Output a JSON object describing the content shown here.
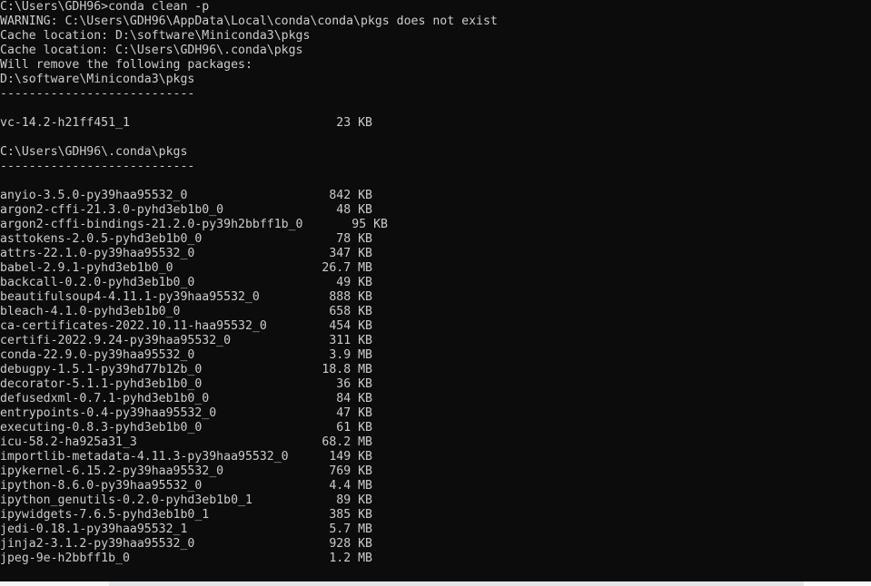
{
  "window": {
    "title": "Command Prompt - conda clean -p",
    "background_color": "#0c0c0c",
    "foreground_color": "#cccccc"
  },
  "console": {
    "prompt_line": "C:\\Users\\GDH96>conda clean -p",
    "warning_line": "WARNING: C:\\Users\\GDH96\\AppData\\Local\\conda\\conda\\pkgs does not exist",
    "cache_location_1": "Cache location: D:\\software\\Miniconda3\\pkgs",
    "cache_location_2": "Cache location: C:\\Users\\GDH96\\.conda\\pkgs",
    "will_remove_line": "Will remove the following packages:",
    "separator": "---------------------------",
    "section_1": {
      "path": "D:\\software\\Miniconda3\\pkgs",
      "packages": [
        {
          "name": "vc-14.2-h21ff451_1",
          "size": "23 KB"
        }
      ]
    },
    "section_2": {
      "path": "C:\\Users\\GDH96\\.conda\\pkgs",
      "packages": [
        {
          "name": "anyio-3.5.0-py39haa95532_0",
          "size": "842 KB"
        },
        {
          "name": "argon2-cffi-21.3.0-pyhd3eb1b0_0",
          "size": "48 KB"
        },
        {
          "name": "argon2-cffi-bindings-21.2.0-py39h2bbff1b_0",
          "size": "95 KB",
          "shifted": true
        },
        {
          "name": "asttokens-2.0.5-pyhd3eb1b0_0",
          "size": "78 KB"
        },
        {
          "name": "attrs-22.1.0-py39haa95532_0",
          "size": "347 KB"
        },
        {
          "name": "babel-2.9.1-pyhd3eb1b0_0",
          "size": "26.7 MB"
        },
        {
          "name": "backcall-0.2.0-pyhd3eb1b0_0",
          "size": "49 KB"
        },
        {
          "name": "beautifulsoup4-4.11.1-py39haa95532_0",
          "size": "888 KB"
        },
        {
          "name": "bleach-4.1.0-pyhd3eb1b0_0",
          "size": "658 KB"
        },
        {
          "name": "ca-certificates-2022.10.11-haa95532_0",
          "size": "454 KB"
        },
        {
          "name": "certifi-2022.9.24-py39haa95532_0",
          "size": "311 KB"
        },
        {
          "name": "conda-22.9.0-py39haa95532_0",
          "size": "3.9 MB"
        },
        {
          "name": "debugpy-1.5.1-py39hd77b12b_0",
          "size": "18.8 MB"
        },
        {
          "name": "decorator-5.1.1-pyhd3eb1b0_0",
          "size": "36 KB"
        },
        {
          "name": "defusedxml-0.7.1-pyhd3eb1b0_0",
          "size": "84 KB"
        },
        {
          "name": "entrypoints-0.4-py39haa95532_0",
          "size": "47 KB"
        },
        {
          "name": "executing-0.8.3-pyhd3eb1b0_0",
          "size": "61 KB"
        },
        {
          "name": "icu-58.2-ha925a31_3",
          "size": "68.2 MB"
        },
        {
          "name": "importlib-metadata-4.11.3-py39haa95532_0",
          "size": "149 KB"
        },
        {
          "name": "ipykernel-6.15.2-py39haa95532_0",
          "size": "769 KB"
        },
        {
          "name": "ipython-8.6.0-py39haa95532_0",
          "size": "4.4 MB"
        },
        {
          "name": "ipython_genutils-0.2.0-pyhd3eb1b0_1",
          "size": "89 KB"
        },
        {
          "name": "ipywidgets-7.6.5-pyhd3eb1b0_1",
          "size": "385 KB"
        },
        {
          "name": "jedi-0.18.1-py39haa95532_1",
          "size": "5.7 MB"
        },
        {
          "name": "jinja2-3.1.2-py39haa95532_0",
          "size": "928 KB"
        },
        {
          "name": "jpeg-9e-h2bbff1b_0",
          "size": "1.2 MB"
        }
      ]
    }
  }
}
